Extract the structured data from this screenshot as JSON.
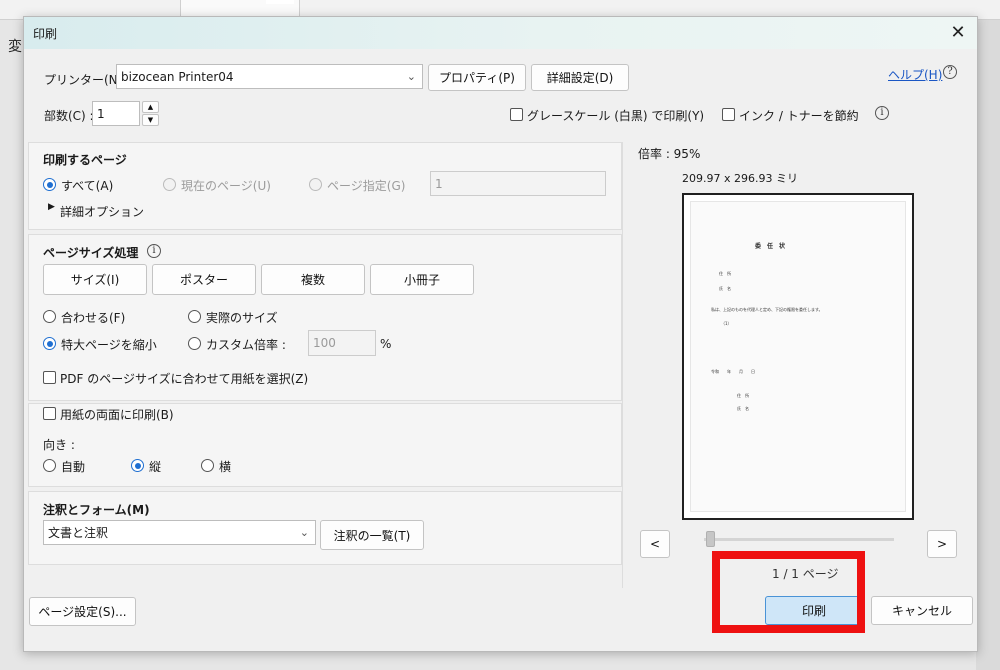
{
  "background": {
    "left_char": "変"
  },
  "dialog": {
    "title": "印刷",
    "close_label": "✕",
    "help_link": "ヘルプ(H)",
    "printer": {
      "label": "プリンター(N) :",
      "value": "bizocean Printer04",
      "properties_button": "プロパティ(P)",
      "advanced_button": "詳細設定(D)"
    },
    "copies": {
      "label": "部数(C) :",
      "value": "1"
    },
    "grayscale_label": "グレースケール (白黒) で印刷(Y)",
    "save_ink_label": "インク / トナーを節約",
    "pages_to_print": {
      "title": "印刷するページ",
      "all": "すべて(A)",
      "current": "現在のページ(U)",
      "range": "ページ指定(G)",
      "range_value": "1",
      "more_options": "詳細オプション"
    },
    "page_sizing": {
      "title": "ページサイズ処理",
      "tabs": [
        "サイズ(I)",
        "ポスター",
        "複数",
        "小冊子"
      ],
      "fit": "合わせる(F)",
      "actual_size": "実際のサイズ",
      "shrink_oversized": "特大ページを縮小",
      "custom_scale": "カスタム倍率 :",
      "custom_scale_value": "100",
      "percent_sign": "%",
      "pdf_page_size": "PDF のページサイズに合わせて用紙を選択(Z)"
    },
    "duplex_label": "用紙の両面に印刷(B)",
    "orientation": {
      "label": "向き :",
      "auto": "自動",
      "portrait": "縦",
      "landscape": "横"
    },
    "comments_forms": {
      "title": "注釈とフォーム(M)",
      "value": "文書と注釈",
      "summarize_button": "注釈の一覧(T)"
    },
    "preview": {
      "scale_text": "倍率 : 95%",
      "size_text": "209.97 x 296.93 ミリ",
      "prev_label": "<",
      "next_label": ">",
      "page_indicator": "1 / 1 ページ"
    },
    "document": {
      "title": "委　任　状",
      "lines": [
        "住　所",
        "氏　名",
        "私は、上記のものを代理人と定め、下記の権限を委任します。",
        "（1）",
        "令和　　年　　月　　日",
        "住　所",
        "氏　名"
      ]
    },
    "page_setup_button": "ページ設定(S)...",
    "print_button": "印刷",
    "cancel_button": "キャンセル",
    "highlight_color": "#ee1111"
  }
}
